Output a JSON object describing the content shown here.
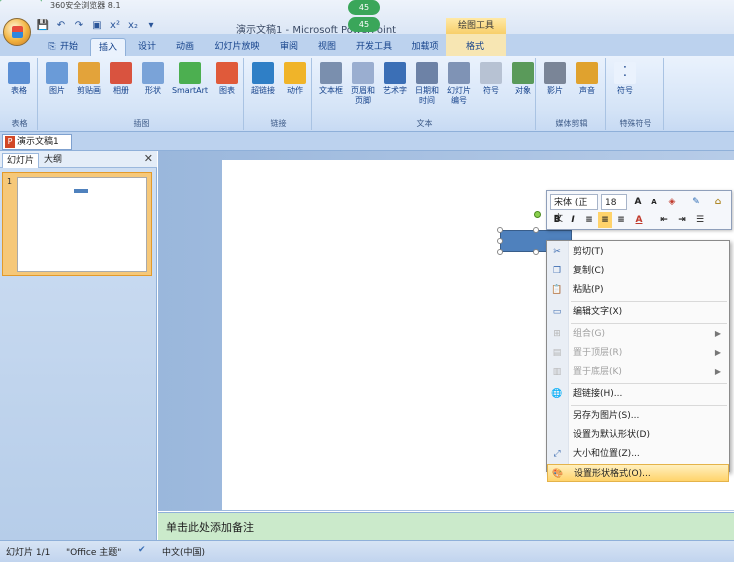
{
  "browser": {
    "title": "360安全浏览器 8.1"
  },
  "window": {
    "title": "演示文稿1 - Microsoft PowerPoint",
    "badge_top": "45",
    "badge_bottom": "45",
    "contextual_tab_group": "绘图工具"
  },
  "tabs": [
    "开始",
    "插入",
    "设计",
    "动画",
    "幻灯片放映",
    "审阅",
    "视图",
    "开发工具",
    "加载项",
    "格式"
  ],
  "active_tab": "插入",
  "ribbon": {
    "groups": [
      {
        "name": "表格",
        "buttons": [
          {
            "label": "表格",
            "icon": "table-icon",
            "color": "#5b8fd4"
          }
        ]
      },
      {
        "name": "插图",
        "buttons": [
          {
            "label": "图片",
            "icon": "picture-icon",
            "color": "#6a9bd8"
          },
          {
            "label": "剪贴画",
            "icon": "clipart-icon",
            "color": "#e3a33a"
          },
          {
            "label": "相册",
            "icon": "album-icon",
            "color": "#d9533f"
          },
          {
            "label": "形状",
            "icon": "shapes-icon",
            "color": "#7aa3d8"
          },
          {
            "label": "SmartArt",
            "icon": "smartart-icon",
            "color": "#4caf50"
          },
          {
            "label": "图表",
            "icon": "chart-icon",
            "color": "#e05a3a"
          }
        ]
      },
      {
        "name": "链接",
        "buttons": [
          {
            "label": "超链接",
            "icon": "globe-icon",
            "color": "#2f7fc6"
          },
          {
            "label": "动作",
            "icon": "star-icon",
            "color": "#f0b429"
          }
        ]
      },
      {
        "name": "文本",
        "buttons": [
          {
            "label": "文本框",
            "icon": "textbox-icon",
            "color": "#7a8fae"
          },
          {
            "label": "页眉和\n页脚",
            "icon": "header-footer-icon",
            "color": "#9aaed0"
          },
          {
            "label": "艺术字",
            "icon": "wordart-icon",
            "color": "#3b6fb6"
          },
          {
            "label": "日期和\n时间",
            "icon": "calendar-icon",
            "color": "#6d82a6"
          },
          {
            "label": "幻灯片\n编号",
            "icon": "slide-number-icon",
            "color": "#7f93b5"
          },
          {
            "label": "符号",
            "icon": "omega-icon",
            "color": "#b7c2d3"
          },
          {
            "label": "对象",
            "icon": "object-icon",
            "color": "#5a9a5a"
          }
        ]
      },
      {
        "name": "媒体剪辑",
        "buttons": [
          {
            "label": "影片",
            "icon": "film-icon",
            "color": "#7a8597"
          },
          {
            "label": "声音",
            "icon": "speaker-icon",
            "color": "#e0a22e"
          }
        ]
      },
      {
        "name": "特殊符号",
        "buttons": [
          {
            "label": "符号",
            "icon": "punctuation-icon",
            "color": "#eaf2fd"
          }
        ]
      }
    ]
  },
  "document_tab": "演示文稿1",
  "left_panel": {
    "tabs": [
      "幻灯片",
      "大纲"
    ],
    "slide_number": "1"
  },
  "notes_placeholder": "单击此处添加备注",
  "status": {
    "slide": "幻灯片 1/1",
    "theme": "\"Office 主题\"",
    "language": "中文(中国)"
  },
  "mini_toolbar": {
    "font": "宋体 (正文",
    "size": "18",
    "buttons_row1": [
      "A",
      "A",
      "⌫",
      "✎",
      "⌂"
    ],
    "buttons_row2": [
      "B",
      "I",
      "≡",
      "≡",
      "≡",
      "A",
      "⇤",
      "⇥",
      "☰"
    ]
  },
  "context_menu": [
    {
      "label": "剪切(T)",
      "icon": "scissors-icon",
      "glyph": "✂",
      "disabled": false
    },
    {
      "label": "复制(C)",
      "icon": "copy-icon",
      "glyph": "❐",
      "disabled": false
    },
    {
      "label": "粘贴(P)",
      "icon": "paste-icon",
      "glyph": "📋",
      "disabled": false
    },
    {
      "sep": true
    },
    {
      "label": "编辑文字(X)",
      "icon": "edit-text-icon",
      "glyph": "▭",
      "disabled": false
    },
    {
      "sep": true
    },
    {
      "label": "组合(G)",
      "icon": "group-icon",
      "glyph": "⊞",
      "disabled": true,
      "submenu": true
    },
    {
      "label": "置于顶层(R)",
      "icon": "bring-front-icon",
      "glyph": "▤",
      "disabled": true,
      "submenu": true
    },
    {
      "label": "置于底层(K)",
      "icon": "send-back-icon",
      "glyph": "▥",
      "disabled": true,
      "submenu": true
    },
    {
      "sep": true
    },
    {
      "label": "超链接(H)...",
      "icon": "hyperlink-icon",
      "glyph": "🌐",
      "disabled": false
    },
    {
      "sep": true
    },
    {
      "label": "另存为图片(S)...",
      "icon": "",
      "glyph": "",
      "disabled": false
    },
    {
      "label": "设置为默认形状(D)",
      "icon": "",
      "glyph": "",
      "disabled": false
    },
    {
      "label": "大小和位置(Z)...",
      "icon": "size-position-icon",
      "glyph": "⤢",
      "disabled": false
    },
    {
      "label": "设置形状格式(O)...",
      "icon": "format-shape-icon",
      "glyph": "🎨",
      "disabled": false,
      "highlighted": true
    }
  ]
}
